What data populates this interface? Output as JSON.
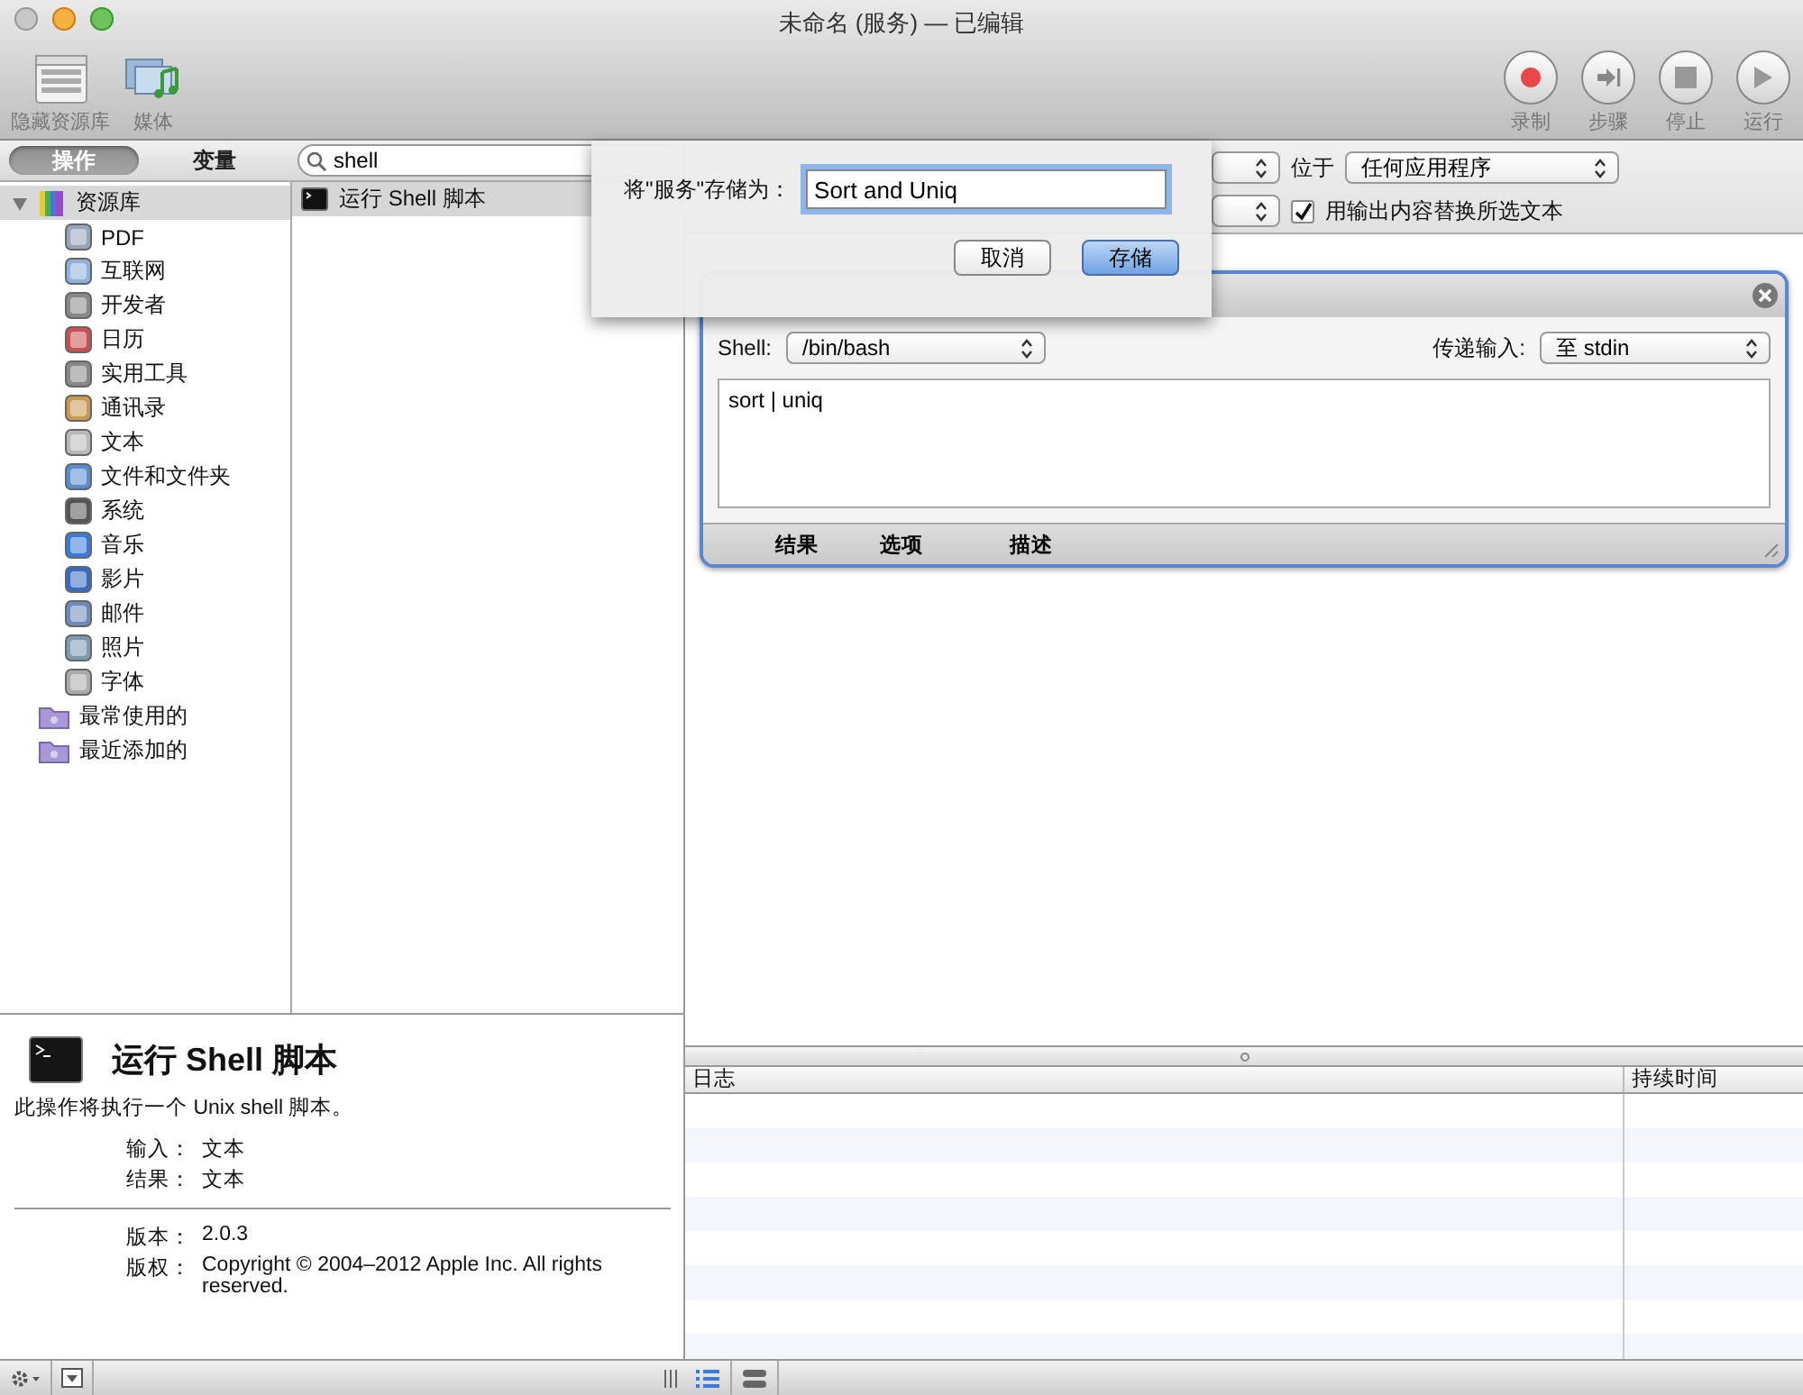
{
  "window": {
    "title": "未命名 (服务) — 已编辑"
  },
  "toolbar": {
    "left": [
      {
        "kind": "library",
        "label": "隐藏资源库"
      },
      {
        "kind": "media",
        "label": "媒体"
      }
    ],
    "right": [
      {
        "kind": "record",
        "label": "录制"
      },
      {
        "kind": "step",
        "label": "步骤"
      },
      {
        "kind": "stop",
        "label": "停止"
      },
      {
        "kind": "run",
        "label": "运行"
      }
    ]
  },
  "mode_tabs": [
    {
      "label": "操作",
      "selected": true
    },
    {
      "label": "变量",
      "selected": false
    }
  ],
  "search": {
    "value": "shell"
  },
  "library": [
    {
      "label": "资源库",
      "kind": "library",
      "expanded": true,
      "children": [
        {
          "label": "PDF"
        },
        {
          "label": "互联网"
        },
        {
          "label": "开发者"
        },
        {
          "label": "日历"
        },
        {
          "label": "实用工具"
        },
        {
          "label": "通讯录"
        },
        {
          "label": "文本"
        },
        {
          "label": "文件和文件夹"
        },
        {
          "label": "系统"
        },
        {
          "label": "音乐"
        },
        {
          "label": "影片"
        },
        {
          "label": "邮件"
        },
        {
          "label": "照片"
        },
        {
          "label": "字体"
        }
      ]
    },
    {
      "label": "最常使用的",
      "kind": "smart-folder"
    },
    {
      "label": "最近添加的",
      "kind": "smart-folder"
    }
  ],
  "actions": [
    {
      "label": "运行 Shell 脚本",
      "selected": true
    }
  ],
  "description": {
    "title": "运行 Shell 脚本",
    "summary": "此操作将执行一个 Unix shell 脚本。",
    "io": [
      {
        "label": "输入：",
        "value": "文本"
      },
      {
        "label": "结果：",
        "value": "文本"
      }
    ],
    "meta": [
      {
        "label": "版本：",
        "value": "2.0.3"
      },
      {
        "label": "版权：",
        "value": "Copyright © 2004–2012 Apple Inc.  All rights reserved."
      }
    ]
  },
  "workflow_header": {
    "location_label": "位于",
    "location": "任何应用程序",
    "replace_output": {
      "label": "用输出内容替换所选文本",
      "checked": true
    }
  },
  "action_card": {
    "shell_label": "Shell:",
    "shell": "/bin/bash",
    "input_label": "传递输入:",
    "input": "至 stdin",
    "script": "sort | uniq",
    "footer_tabs": [
      {
        "label": "结果"
      },
      {
        "label": "选项"
      },
      {
        "label": "描述"
      }
    ]
  },
  "log": {
    "columns": [
      "日志",
      "持续时间"
    ]
  },
  "bottom_bar": {
    "view_buttons": [
      {
        "kind": "list",
        "selected": true
      },
      {
        "kind": "stack",
        "selected": false
      }
    ]
  },
  "save_sheet": {
    "label": "将\"服务\"存储为：",
    "value": "Sort and Uniq",
    "buttons": [
      {
        "label": "取消",
        "default": false
      },
      {
        "label": "存储",
        "default": true
      }
    ]
  }
}
